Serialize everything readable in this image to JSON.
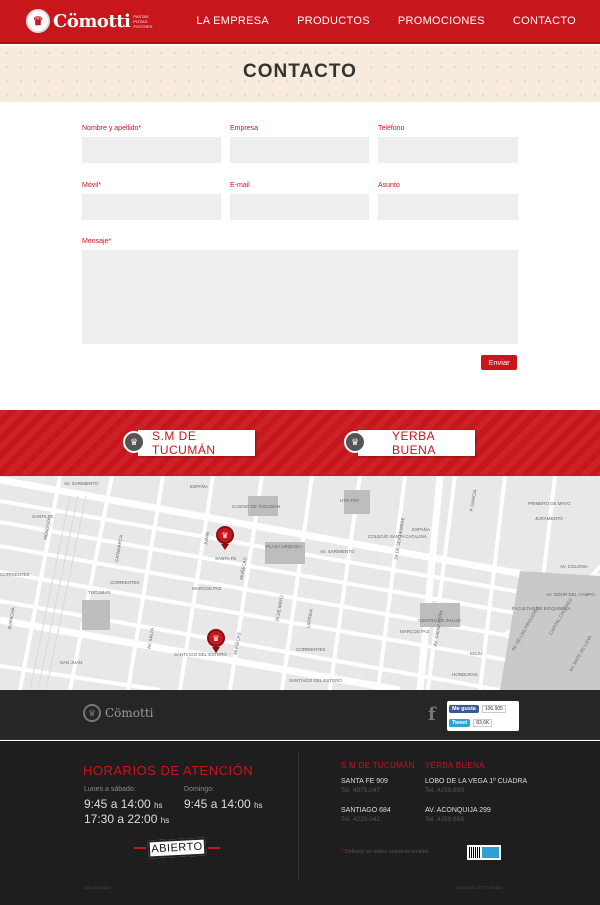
{
  "header": {
    "brand": "Cömotti",
    "tagline": "PASTAS PIZZAS POSTRES",
    "nav": [
      "LA EMPRESA",
      "PRODUCTOS",
      "PROMOCIONES",
      "CONTACTO"
    ]
  },
  "page_title": "CONTACTO",
  "form": {
    "fields": {
      "nombre": "Nombre y apellido*",
      "empresa": "Empresa",
      "telefono": "Teléfono",
      "movil": "Móvil*",
      "email": "E-mail",
      "asunto": "Asunto",
      "mensaje": "Mensaje*"
    },
    "submit": "Enviar"
  },
  "locations": [
    "S.M DE TUCUMÁN",
    "YERBA BUENA"
  ],
  "map": {
    "streets": [
      "AV. SARMIENTO",
      "SANTA FE",
      "CORRIENTES",
      "MARCOS PAZ",
      "SANTIAGO DEL ESTERO",
      "SAN JUAN",
      "MUÑECAS",
      "24 DE SEPTIEMBRE",
      "LAPRIDA",
      "25 DE MAYO",
      "JUNIN",
      "CATAMARCA",
      "AV. SALTA",
      "ESPAÑA",
      "HONDURAS",
      "EEUU",
      "P. GARCIA",
      "JURAMENTO",
      "PRIMERO DE MAYO",
      "AV. SAENZ PEÑA",
      "AV. DE LOS PROCERES",
      "AV. GDOR DEL CAMPO",
      "CAPITAL CACERES",
      "AV. COLONIA",
      "MENDOZA",
      "SUIPACHA",
      "AV. MATE DE LUNA"
    ],
    "places": [
      "Casino de Tucumán",
      "Plaza Urquiza",
      "UTN-FRT",
      "Colegio Santa Catalina",
      "Centro de Salud",
      "Tucuman",
      "Facultad de Bioquímica"
    ]
  },
  "footer": {
    "brand": "Cömotti",
    "social": {
      "like": "Me gusta",
      "like_count": "106.905",
      "tweet": "Tweet",
      "tweet_count": "83,6K"
    },
    "hours_title": "HORARIOS DE ATENCIÓN",
    "weekday_label": "Lunes a sábado:",
    "weekday_1": "9:45 a 14:00",
    "weekday_2": "17:30 a 22:00",
    "sunday_label": "Domingo:",
    "sunday_1": "9:45 a 14:00",
    "hs": "hs",
    "status": "ABIERTO",
    "branches": [
      {
        "name": "S.M DE TUCUMÁN",
        "addr1": "SANTA FE 909",
        "tel1": "Tel. 4975.047",
        "addr2": "SANTIAGO 684",
        "tel2": "Tel. 4220.042"
      },
      {
        "name": "YERBA BUENA",
        "addr1": "LOBO DE LA VEGA 1º cuadra",
        "tel1": "Tel. 4258.693",
        "addr2": "AV. ACONQUIJA 299",
        "tel2": "Tel. 4359.658"
      }
    ],
    "delivery": "Delivery en todos nuestros locales",
    "admin": "administrador",
    "dev": "Desarrollo DOT estudio"
  },
  "colors": {
    "brand_red": "#c8161d",
    "footer_dark": "#1e1e1e"
  }
}
